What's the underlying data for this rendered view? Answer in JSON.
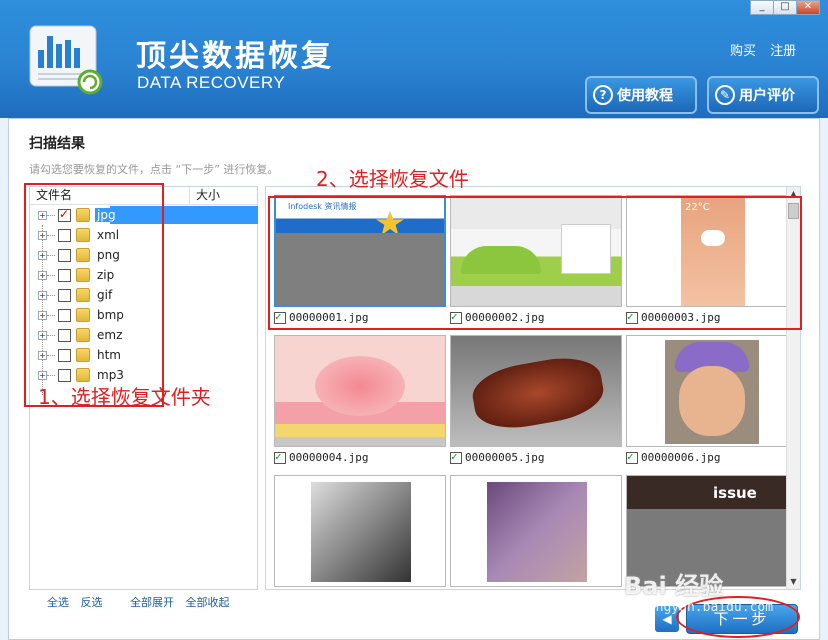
{
  "app": {
    "title": "顶尖数据恢复",
    "subtitle": "DATA RECOVERY",
    "window_controls": [
      "_",
      "□",
      "✕"
    ]
  },
  "header": {
    "buy_label": "购买",
    "register_label": "注册",
    "tutorial_label": "使用教程",
    "review_label": "用户评价"
  },
  "main": {
    "section_title": "扫描结果",
    "hint": "请勾选您要恢复的文件，点击 “下一步” 进行恢复。"
  },
  "tree": {
    "col_name": "文件名",
    "col_size": "大小",
    "items": [
      {
        "label": "jpg",
        "checked": true,
        "selected": true
      },
      {
        "label": "xml",
        "checked": false
      },
      {
        "label": "png",
        "checked": false
      },
      {
        "label": "zip",
        "checked": false
      },
      {
        "label": "gif",
        "checked": false
      },
      {
        "label": "bmp",
        "checked": false
      },
      {
        "label": "emz",
        "checked": false
      },
      {
        "label": "htm",
        "checked": false
      },
      {
        "label": "mp3",
        "checked": false
      }
    ],
    "select_all": "全选",
    "invert": "反选",
    "expand_all": "全部展开",
    "collapse_all": "全部收起"
  },
  "files": [
    {
      "name": "00000001.jpg",
      "checked": true,
      "thumb_text": "Infodesk 资讯情报"
    },
    {
      "name": "00000002.jpg",
      "checked": true
    },
    {
      "name": "00000003.jpg",
      "checked": true,
      "thumb_text": "22°C"
    },
    {
      "name": "00000004.jpg",
      "checked": true
    },
    {
      "name": "00000005.jpg",
      "checked": true
    },
    {
      "name": "00000006.jpg",
      "checked": true
    },
    {
      "name": "",
      "checked": false
    },
    {
      "name": "",
      "checked": false
    },
    {
      "name": "",
      "checked": false,
      "thumb_text": "issue"
    }
  ],
  "annotations": {
    "step1": "1、选择恢复文件夹",
    "step2": "2、选择恢复文件"
  },
  "footer": {
    "prev_label": "◀",
    "next_label": "下一步"
  },
  "watermark": {
    "brand": "Bai 经验",
    "url": "jingyan.baidu.com"
  },
  "colors": {
    "header_blue": "#2a83d2",
    "annotation_red": "#e02020",
    "selection_blue": "#3399ff"
  }
}
